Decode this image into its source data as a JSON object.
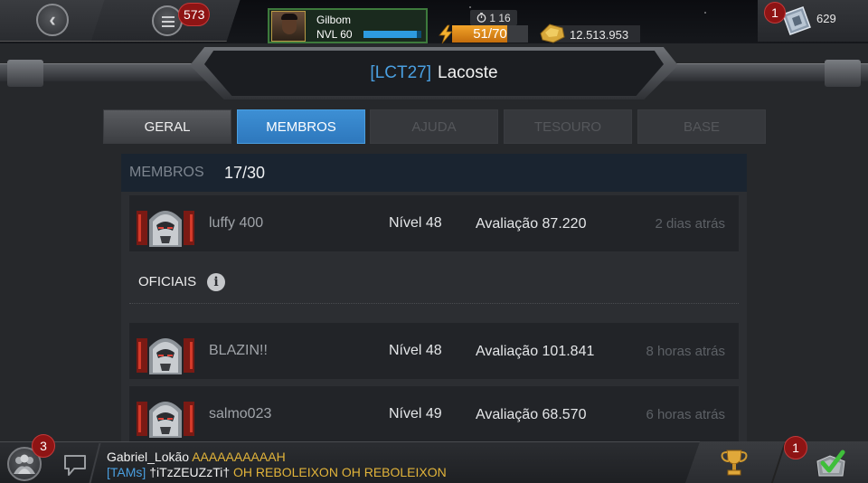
{
  "topbar": {
    "notifications_count": "573",
    "player": {
      "name": "Gilbom",
      "level": "NVL 60",
      "xp_fraction": 0.92
    },
    "timer": "1 16",
    "energy": {
      "display": "51/70",
      "current": 51,
      "max": 70
    },
    "gold": "12.513.953",
    "crystals": {
      "badge": "1",
      "value": "629"
    }
  },
  "alliance": {
    "tag": "[LCT27]",
    "name": "Lacoste"
  },
  "tabs": [
    {
      "label": "GERAL",
      "state": "normal"
    },
    {
      "label": "MEMBROS",
      "state": "active"
    },
    {
      "label": "AJUDA",
      "state": "disabled"
    },
    {
      "label": "TESOURO",
      "state": "disabled"
    },
    {
      "label": "BASE",
      "state": "disabled"
    }
  ],
  "members": {
    "label": "MEMBROS",
    "count": "17/30",
    "leader": {
      "name": "luffy 400",
      "level": "Nível 48",
      "rating": "Avaliação 87.220",
      "last_seen": "2 dias atrás"
    },
    "officers_label": "OFICIAIS",
    "officers": [
      {
        "name": "BLAZIN!!",
        "level": "Nível 48",
        "rating": "Avaliação 101.841",
        "last_seen": "8 horas atrás"
      },
      {
        "name": "salmo023",
        "level": "Nível 49",
        "rating": "Avaliação 68.570",
        "last_seen": "6 horas atrás"
      }
    ]
  },
  "bottombar": {
    "alliance_badge": "3",
    "chat": [
      {
        "user": "Gabriel_Lokão",
        "message": "AAAAAAAAAAH"
      },
      {
        "tag": "[TAMs]",
        "user": "†iTzZEUZzTi†",
        "message": "OH REBOLEIXON OH REBOLEIXON"
      }
    ],
    "quests_badge": "1"
  },
  "colors": {
    "accent_blue": "#2e78bd",
    "badge_red": "#8e1414",
    "chat_gold": "#e2b43a",
    "energy_orange": "#f2a42a"
  },
  "icons": [
    "back-arrow-icon",
    "menu-icon",
    "crystal-icon",
    "timer-icon",
    "energy-bolt-icon",
    "gold-icon",
    "info-icon",
    "alliance-icon",
    "chat-icon",
    "trophy-icon",
    "quest-check-icon"
  ]
}
